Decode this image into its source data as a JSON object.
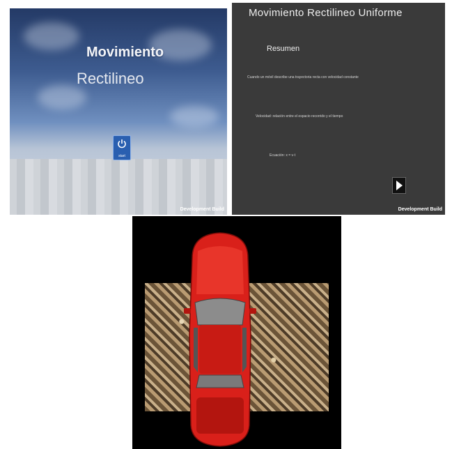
{
  "panel_intro": {
    "title_line1": "Movimiento",
    "title_line2": "Rectilineo",
    "start_button_label": "start",
    "brand": "Development Build"
  },
  "panel_summary": {
    "title": "Movimiento Rectilineo Uniforme",
    "subtitle": "Resumen",
    "line1": "Cuando un móvil describe una trayectoria recta con velocidad constante",
    "line2": "Velocidad: relación entre el espacio recorrido y el tiempo",
    "line3": "Ecuación: x = v·t",
    "next_icon": "play-arrow-icon",
    "brand": "Development Build"
  },
  "panel_car": {
    "car_color": "#d9201a",
    "ground": "gravel-texture"
  }
}
